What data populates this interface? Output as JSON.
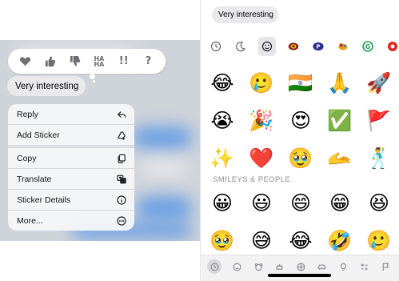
{
  "conversation": {
    "message_text": "Very interesting"
  },
  "tapback": {
    "reactions": [
      "heart-icon",
      "thumbs-up-icon",
      "thumbs-down-icon",
      "haha-icon",
      "exclamation-icon",
      "question-icon"
    ],
    "haha_label": "HA HA",
    "exclaim_label": "!!",
    "question_label": "?"
  },
  "context_menu": {
    "items": [
      {
        "label": "Reply",
        "icon": "reply-arrow-icon"
      },
      {
        "label": "Add Sticker",
        "icon": "sticker-add-icon"
      },
      {
        "label": "Copy",
        "icon": "copy-icon"
      },
      {
        "label": "Translate",
        "icon": "translate-icon"
      },
      {
        "label": "Sticker Details",
        "icon": "info-icon"
      },
      {
        "label": "More...",
        "icon": "more-circle-icon"
      }
    ]
  },
  "emoji_keyboard": {
    "categories": [
      "recent-clock-icon",
      "sticker-moon-icon",
      "smiley-icon",
      "target-sticker-icon",
      "p-sticker-icon",
      "bird-sticker-icon",
      "g-sticker-icon",
      "ball-sticker-icon"
    ],
    "recent_rows": [
      [
        "😂",
        "🥲",
        "🇮🇳",
        "🙏",
        "🚀"
      ],
      [
        "😭",
        "🎉",
        "😍",
        "✅",
        "🚩"
      ],
      [
        "✨",
        "❤️",
        "🥹",
        "🫴",
        "🕺"
      ]
    ],
    "section_label": "SMILEYS & PEOPLE",
    "smiley_rows": [
      [
        "😀",
        "😃",
        "😄",
        "😁",
        "😆"
      ],
      [
        "🥹",
        "😅",
        "😂",
        "🤣",
        "🥲"
      ]
    ],
    "bottom_categories": [
      "clock-icon",
      "smiley-icon",
      "bear-icon",
      "food-icon",
      "ball-icon",
      "car-icon",
      "bulb-icon",
      "symbols-icon",
      "flag-icon"
    ]
  },
  "colors": {
    "bubble_gray": "#e9e9eb",
    "imessage_blue": "#4a8fe6"
  }
}
